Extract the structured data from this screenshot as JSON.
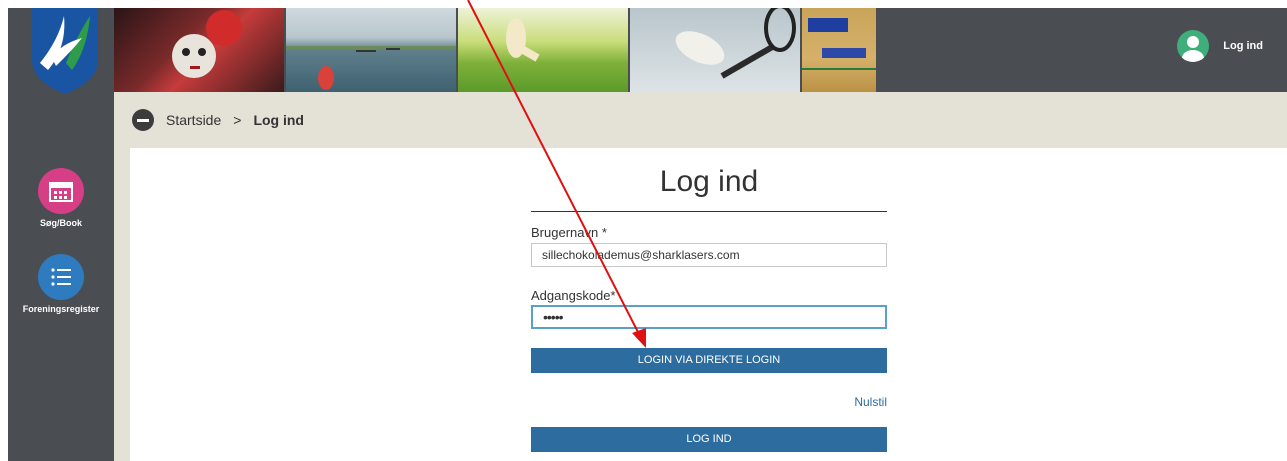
{
  "header": {
    "user_label": "Log ind"
  },
  "sidebar": {
    "items": [
      {
        "label": "Søg/Book",
        "icon": "calendar-icon",
        "color": "#d63e86"
      },
      {
        "label": "Foreningsregister",
        "icon": "list-icon",
        "color": "#2f7bbf"
      }
    ]
  },
  "breadcrumb": {
    "home": "Startside",
    "separator": ">",
    "current": "Log ind"
  },
  "login": {
    "title": "Log ind",
    "username_label": "Brugernavn *",
    "username_value": "sillechokolademus@sharklasers.com",
    "password_label": "Adgangskode*",
    "password_value": "•••••",
    "direct_login_button": "LOGIN VIA DIREKTE LOGIN",
    "reset_link": "Nulstil",
    "login_button": "LOG IND"
  },
  "colors": {
    "sidebar_bg": "#4a4d52",
    "crumb_bg": "#e4e1d6",
    "button_bg": "#2d6c9f",
    "arrow": "#e01010"
  }
}
